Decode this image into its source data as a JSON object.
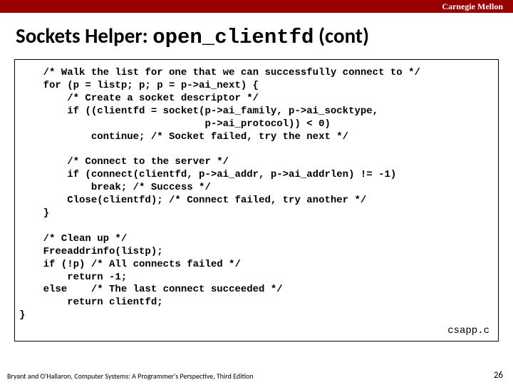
{
  "header": {
    "institution": "Carnegie Mellon"
  },
  "title": {
    "prefix": "Sockets Helper: ",
    "func": "open_clientfd",
    "suffix": " (cont)"
  },
  "code": {
    "text": "    /* Walk the list for one that we can successfully connect to */\n    for (p = listp; p; p = p->ai_next) {\n        /* Create a socket descriptor */\n        if ((clientfd = socket(p->ai_family, p->ai_socktype,\n                               p->ai_protocol)) < 0)\n            continue; /* Socket failed, try the next */\n\n        /* Connect to the server */\n        if (connect(clientfd, p->ai_addr, p->ai_addrlen) != -1)\n            break; /* Success */\n        Close(clientfd); /* Connect failed, try another */\n    }\n\n    /* Clean up */\n    Freeaddrinfo(listp);\n    if (!p) /* All connects failed */\n        return -1;\n    else    /* The last connect succeeded */\n        return clientfd;\n}",
    "source_label": "csapp.c"
  },
  "footer": {
    "text": "Bryant and O'Hallaron, Computer Systems: A Programmer's Perspective, Third Edition",
    "page": "26"
  }
}
